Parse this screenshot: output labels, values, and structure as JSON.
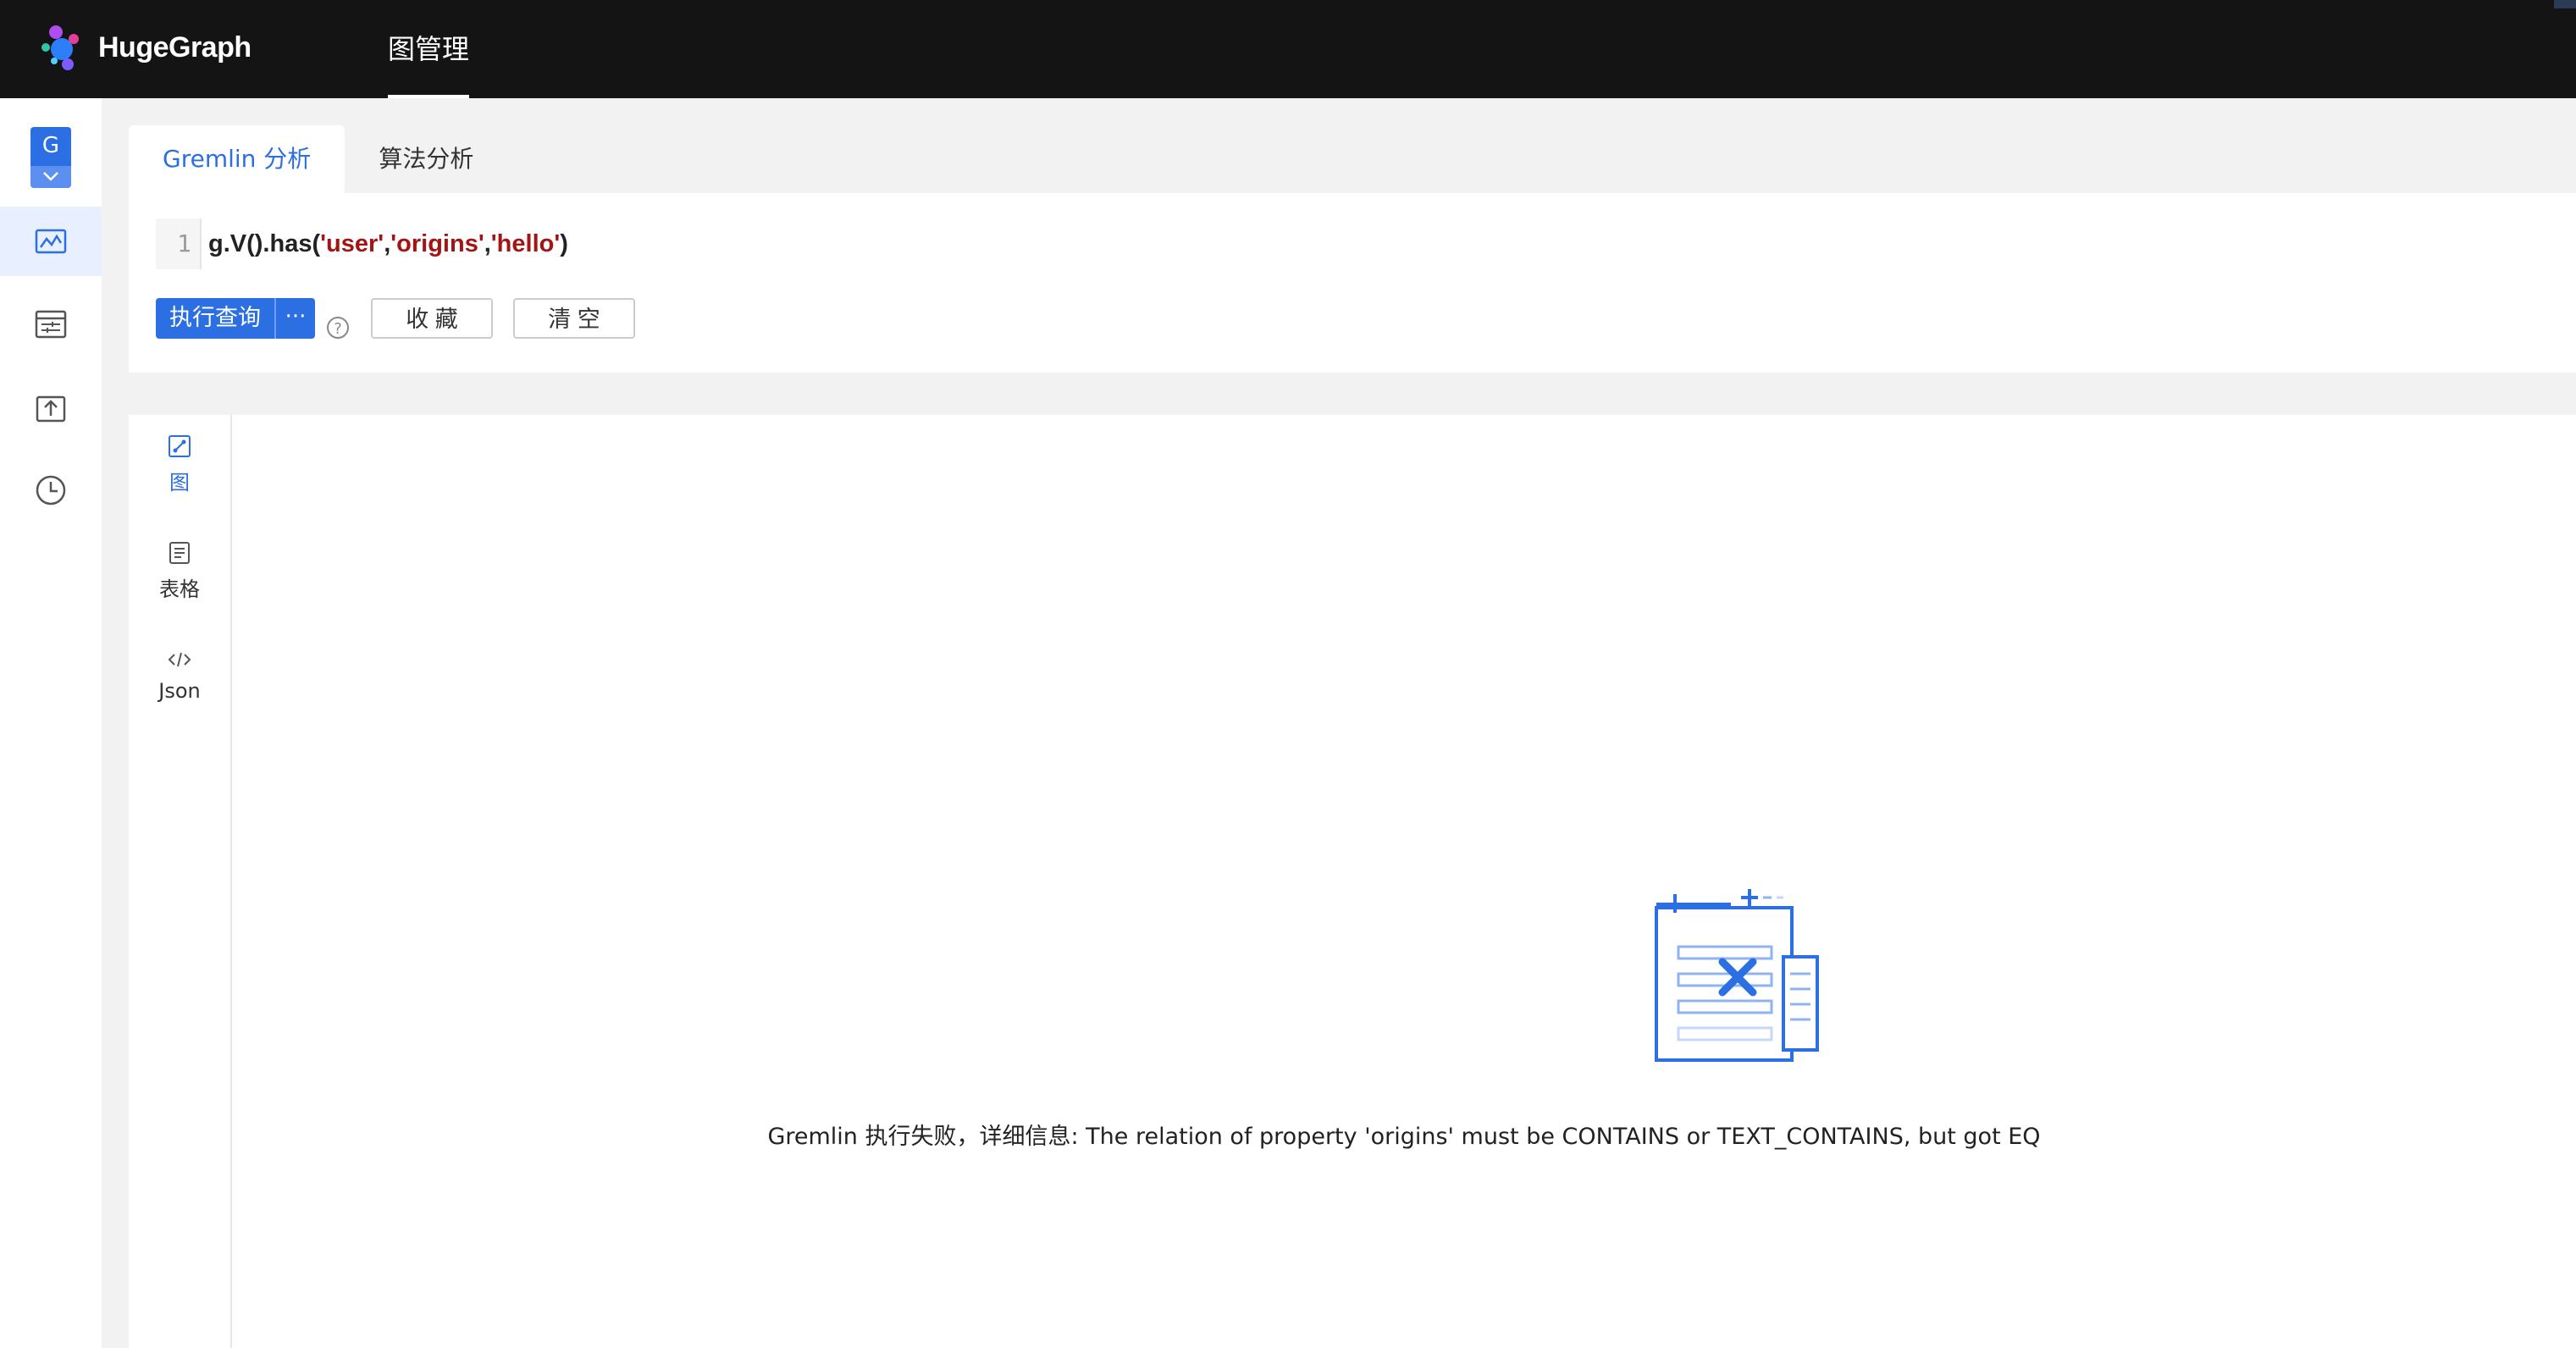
{
  "app": {
    "name": "HugeGraph"
  },
  "topnav": {
    "graph_manage": "图管理"
  },
  "sidebar": {
    "graph_initial": "G",
    "items": [
      {
        "icon": "graph-analysis-icon",
        "active": true
      },
      {
        "icon": "metadata-config-icon",
        "active": false
      },
      {
        "icon": "data-import-icon",
        "active": false
      },
      {
        "icon": "async-task-icon",
        "active": false
      }
    ]
  },
  "tabs": {
    "gremlin": "Gremlin 分析",
    "algorithm": "算法分析"
  },
  "editor": {
    "line_number": "1",
    "code_prefix": "g.V().has(",
    "arg1": "'user'",
    "comma1": ",",
    "arg2": "'origins'",
    "comma2": ",",
    "arg3": "'hello'",
    "code_suffix": ")"
  },
  "actions": {
    "run": "执行查询",
    "more": "···",
    "help": "?",
    "favorite": "收 藏",
    "clear": "清 空"
  },
  "result_views": {
    "graph": "图",
    "table": "表格",
    "json": "Json"
  },
  "result": {
    "error": "Gremlin 执行失败，详细信息: The relation of property 'origins' must be CONTAINS or TEXT_CONTAINS, but got EQ"
  },
  "colors": {
    "accent": "#2b6fe3",
    "topbar": "#141414"
  }
}
